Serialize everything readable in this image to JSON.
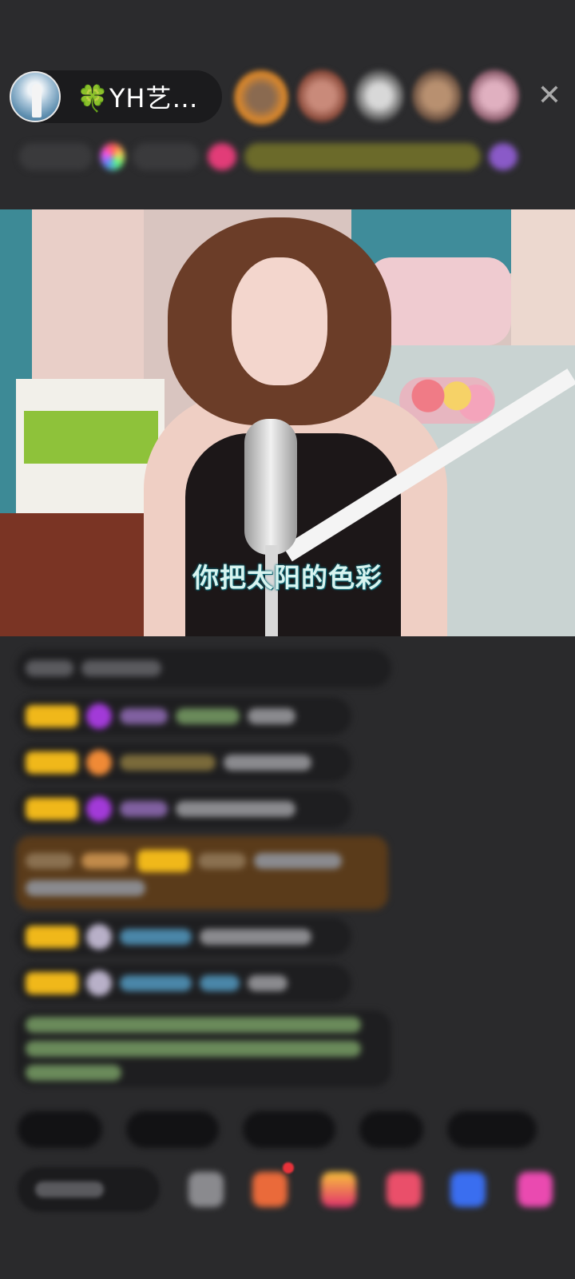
{
  "header": {
    "host_name": "🍀YH艺…",
    "close_icon": "close-icon"
  },
  "video": {
    "lyric": "你把太阳的色彩"
  },
  "colors": {
    "background": "#2a2a2c",
    "pill": "#1b1b1d",
    "lyric_outline": "#0d6d7a",
    "badge_gold": "#f0b81a"
  }
}
